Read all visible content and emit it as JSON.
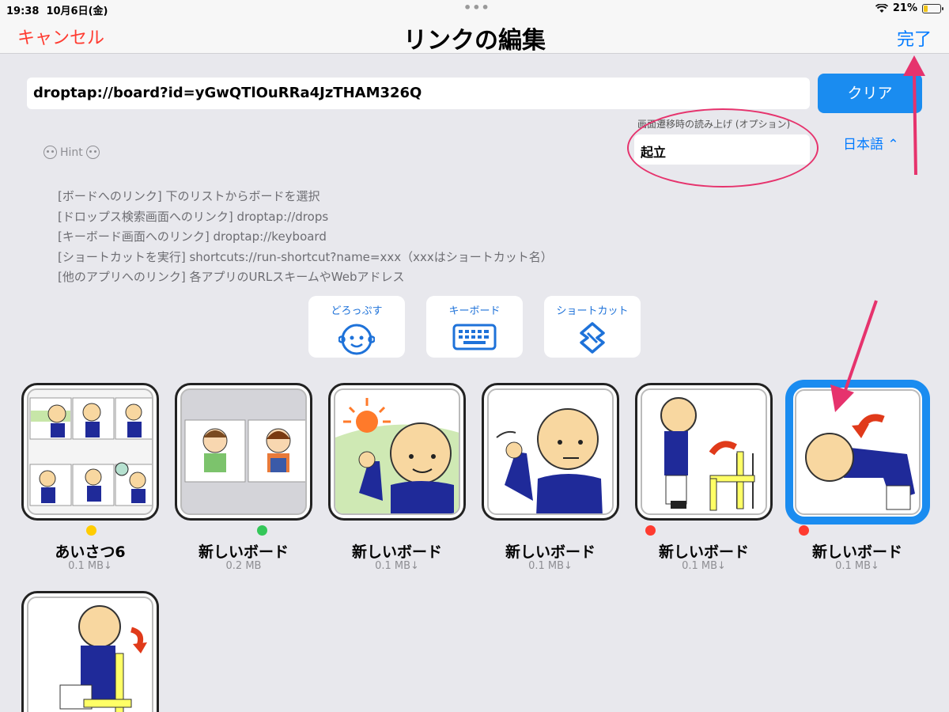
{
  "status_bar": {
    "time": "19:38",
    "date": "10月6日(金)",
    "battery": "21%"
  },
  "nav": {
    "cancel": "キャンセル",
    "title": "リンクの編集",
    "done": "完了"
  },
  "url_field": {
    "value": "droptap://board?id=yGwQTlOuRRa4JzTHAM326Q"
  },
  "clear_button": "クリア",
  "speech": {
    "label": "画面遷移時の読み上げ (オプション)",
    "value": "起立"
  },
  "language": "日本語",
  "hint": {
    "title": "Hint",
    "lines": [
      "[ボードへのリンク] 下のリストからボードを選択",
      "[ドロップス検索画面へのリンク] droptap://drops",
      "[キーボード画面へのリンク] droptap://keyboard",
      "[ショートカットを実行] shortcuts://run-shortcut?name=xxx（xxxはショートカット名）",
      "[他のアプリへのリンク] 各アプリのURLスキームやWebアドレス"
    ]
  },
  "shortcuts": [
    {
      "label": "どろっぷす",
      "icon": "face-icon"
    },
    {
      "label": "キーボード",
      "icon": "keyboard-icon"
    },
    {
      "label": "ショートカット",
      "icon": "shortcuts-icon"
    }
  ],
  "boards": [
    {
      "name": "あいさつ6",
      "size": "0.1 MB↓",
      "dot": "#ffcc00"
    },
    {
      "name": "新しいボード",
      "size": "0.2 MB",
      "dot": "#34c759"
    },
    {
      "name": "新しいボード",
      "size": "0.1 MB↓",
      "dot": ""
    },
    {
      "name": "新しいボード",
      "size": "0.1 MB↓",
      "dot": ""
    },
    {
      "name": "新しいボード",
      "size": "0.1 MB↓",
      "dot": "#ff3b30"
    },
    {
      "name": "新しいボード",
      "size": "0.1 MB↓",
      "dot": "#ff3b30",
      "selected": true
    },
    {
      "name": "",
      "size": "",
      "dot": ""
    }
  ],
  "colors": {
    "accent": "#007aff",
    "cancel": "#ff3b30",
    "annotation": "#e6336d",
    "button": "#1a8cf0"
  }
}
